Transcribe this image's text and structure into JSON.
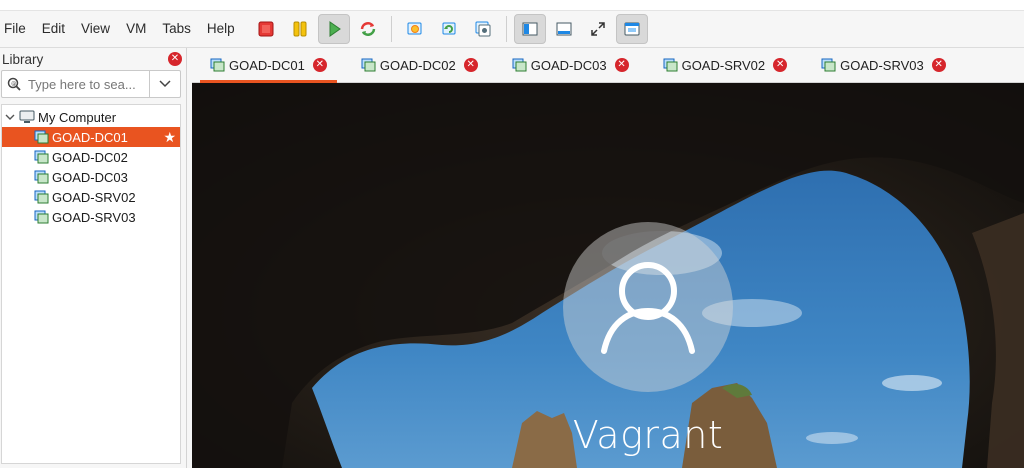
{
  "menu": {
    "items": [
      "File",
      "Edit",
      "View",
      "VM",
      "Tabs",
      "Help"
    ]
  },
  "toolbar": {
    "buttons": [
      "power-off-icon",
      "suspend-icon",
      "play-icon",
      "reset-icon",
      "snapshot-icon",
      "revert-snapshot-icon",
      "manage-snapshots-icon",
      "library-toggle-icon",
      "thumbnail-bar-icon",
      "fullscreen-icon",
      "unity-icon"
    ]
  },
  "library": {
    "title": "Library",
    "search_placeholder": "Type here to sea...",
    "root_label": "My Computer",
    "vms": [
      "GOAD-DC01",
      "GOAD-DC02",
      "GOAD-DC03",
      "GOAD-SRV02",
      "GOAD-SRV03"
    ],
    "selected": "GOAD-DC01"
  },
  "tabs": [
    {
      "label": "GOAD-DC01",
      "active": true
    },
    {
      "label": "GOAD-DC02",
      "active": false
    },
    {
      "label": "GOAD-DC03",
      "active": false
    },
    {
      "label": "GOAD-SRV02",
      "active": false
    },
    {
      "label": "GOAD-SRV03",
      "active": false
    }
  ],
  "console": {
    "username": "Vagrant"
  },
  "colors": {
    "accent": "#e95420",
    "close": "#d6262c"
  }
}
